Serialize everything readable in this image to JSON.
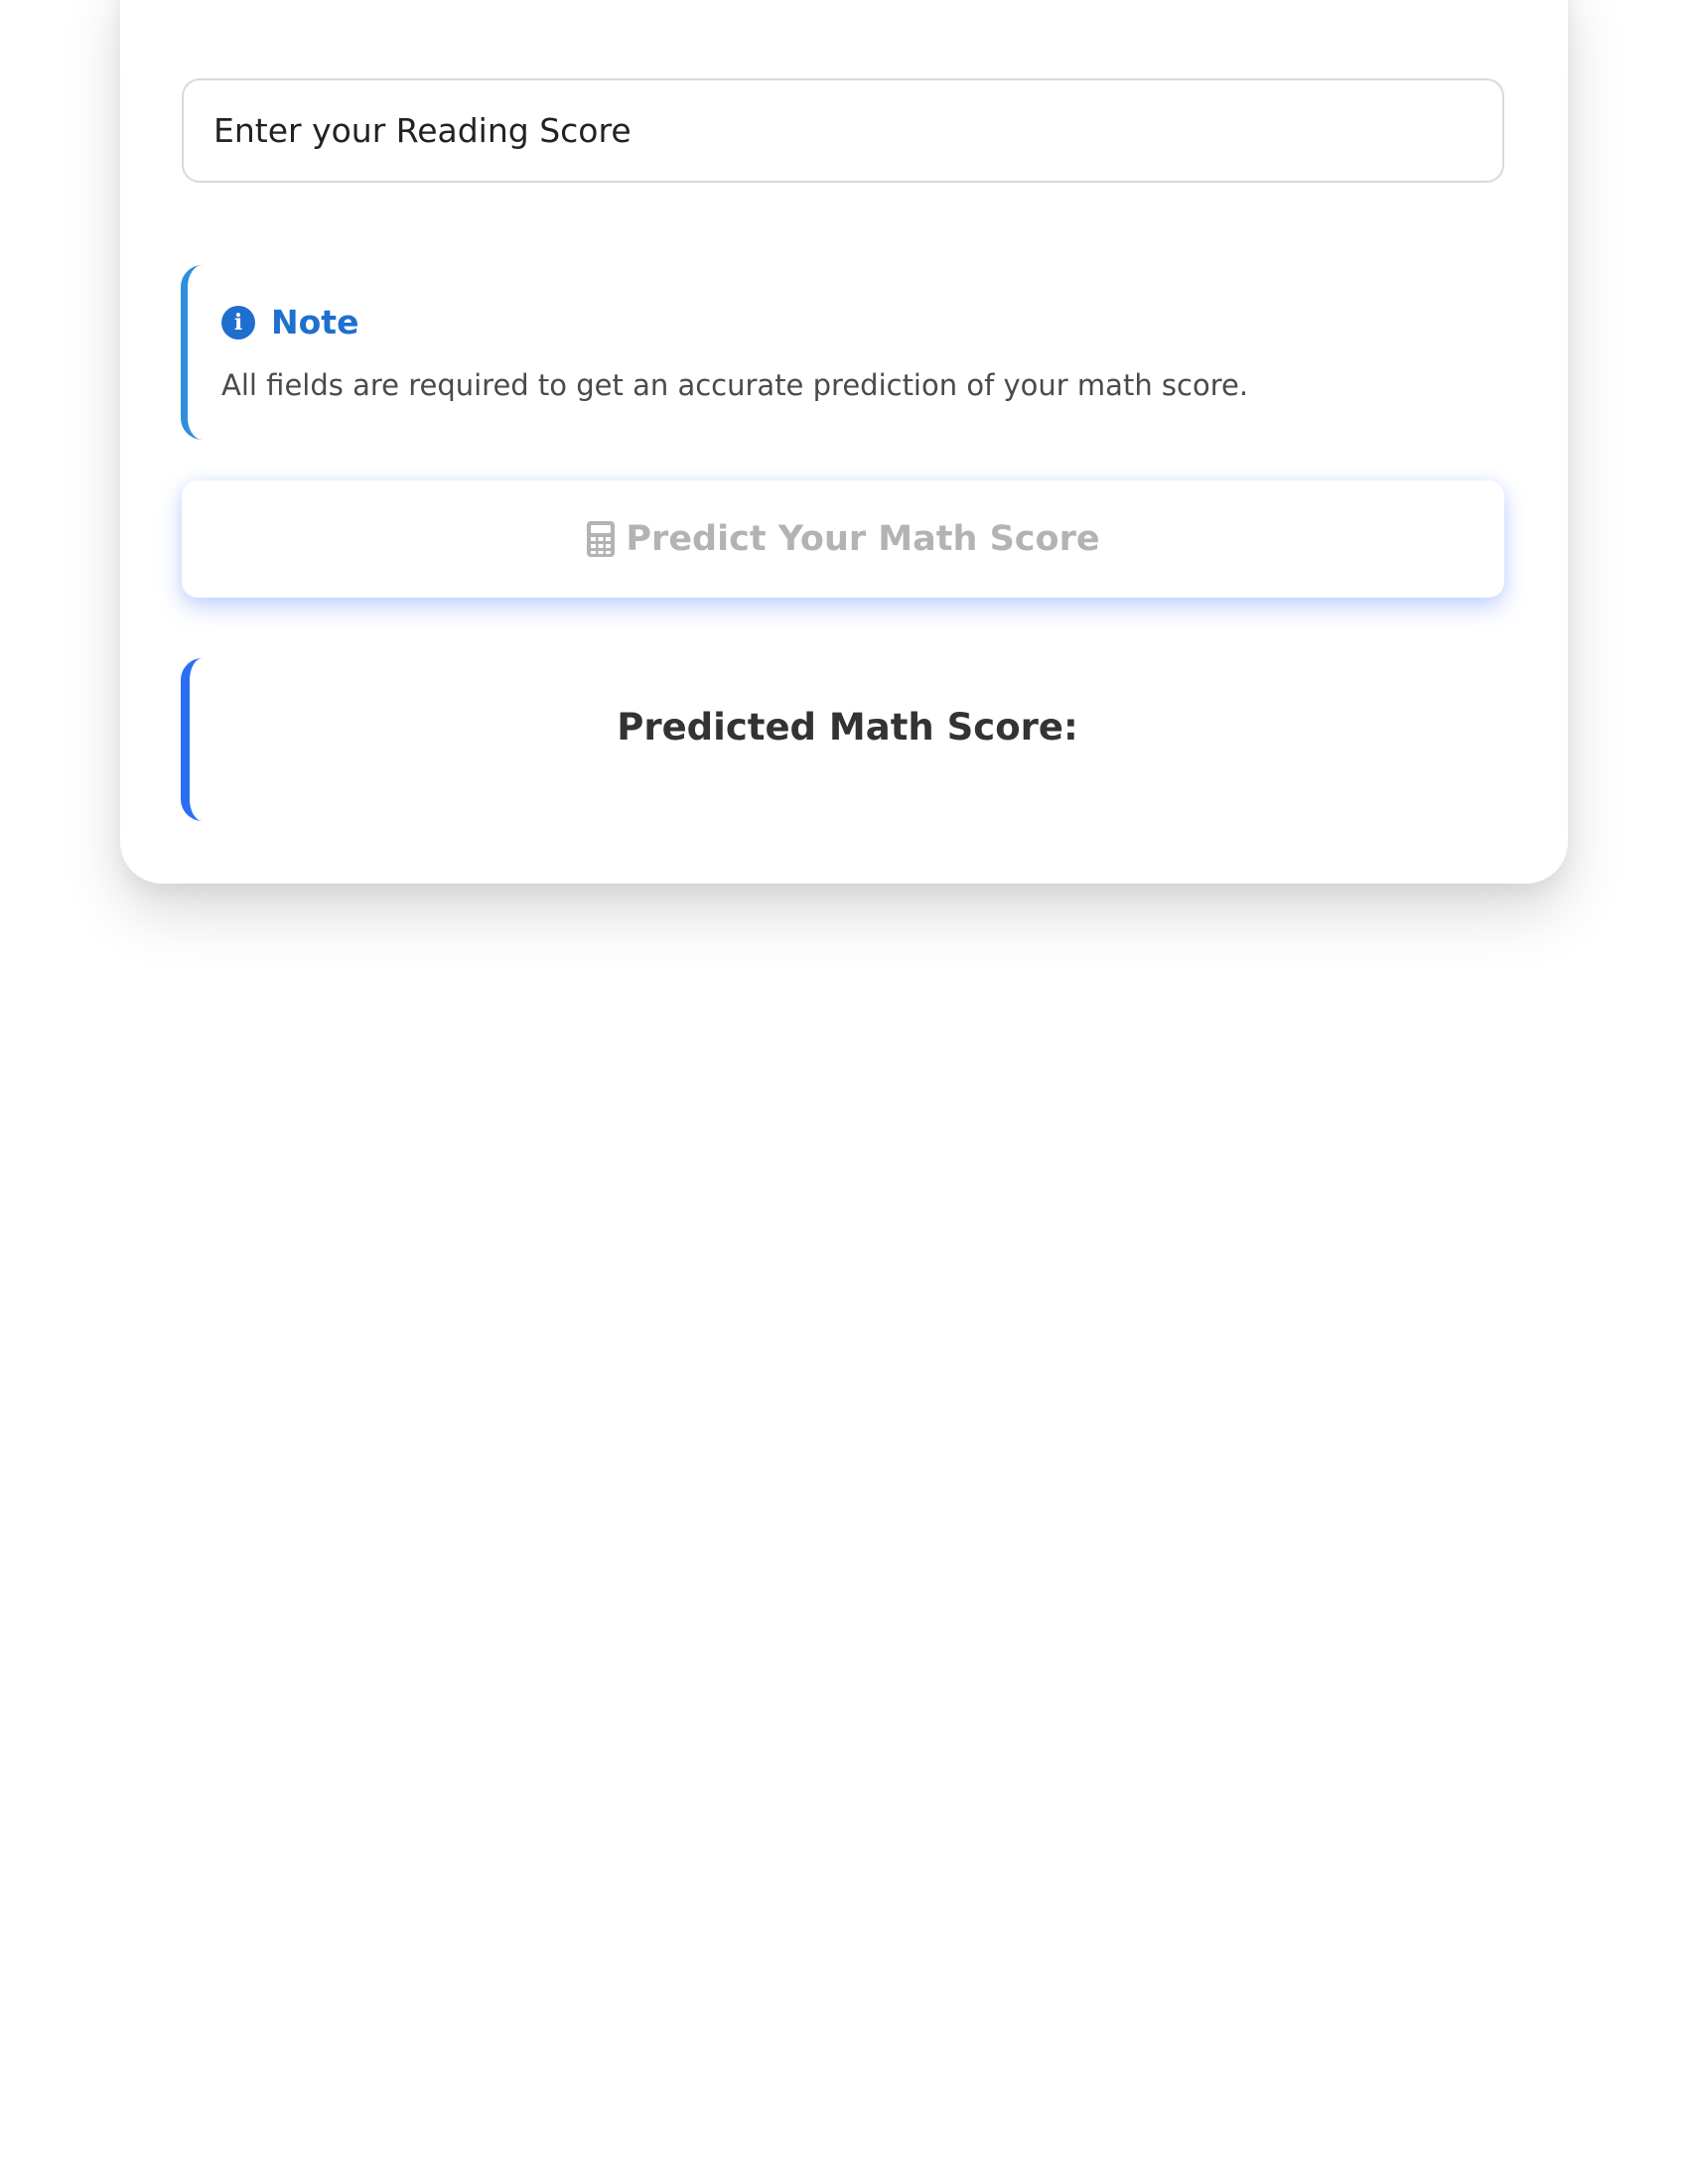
{
  "form": {
    "reading_score_placeholder": "Enter your Reading Score"
  },
  "note": {
    "icon": "info-icon",
    "title": "Note",
    "text": "All fields are required to get an accurate prediction of your math score.",
    "accent_color": "#2f8fde"
  },
  "predict_button": {
    "icon": "calculator-icon",
    "label": "Predict Your Math Score",
    "text_color": "#b3b3b3"
  },
  "result": {
    "label": "Predicted Math Score:",
    "accent_color": "#2a6ff3"
  }
}
